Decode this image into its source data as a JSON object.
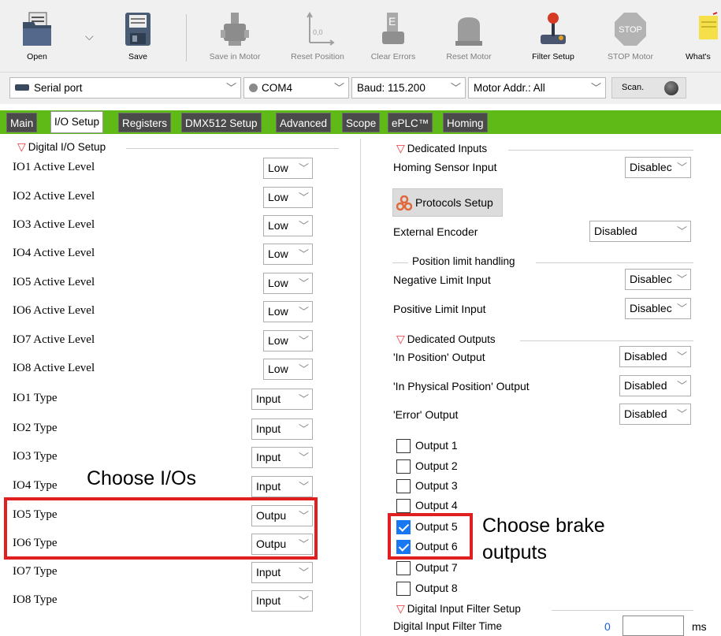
{
  "toolbar": {
    "buttons": [
      {
        "label": "Open",
        "icon": "folder-icon",
        "enabled": true
      },
      {
        "label": "Save",
        "icon": "floppy-disk-icon",
        "enabled": true
      },
      {
        "label": "Save in Motor",
        "icon": "motor-save-icon",
        "enabled": false
      },
      {
        "label": "Reset Position",
        "icon": "axis-reset-icon",
        "enabled": false
      },
      {
        "label": "Clear Errors",
        "icon": "eraser-icon",
        "enabled": false
      },
      {
        "label": "Reset Motor",
        "icon": "motor-reset-icon",
        "enabled": false
      },
      {
        "label": "Filter Setup",
        "icon": "joystick-icon",
        "enabled": true
      },
      {
        "label": "STOP Motor",
        "icon": "stop-sign-icon",
        "enabled": false
      },
      {
        "label": "What's",
        "icon": "sticky-note-icon",
        "enabled": true
      }
    ],
    "stop_sign_text": "STOP"
  },
  "connection": {
    "port_type": "Serial port",
    "com_port": "COM4",
    "baud": "Baud: 115.200",
    "motor_addr": "Motor Addr.: All",
    "scan_label": "Scan."
  },
  "tabs": [
    "Main",
    "I/O Setup",
    "Registers",
    "DMX512 Setup",
    "Advanced",
    "Scope",
    "ePLC™",
    "Homing"
  ],
  "active_tab": "I/O Setup",
  "left": {
    "section_title": "Digital I/O Setup",
    "active_levels": [
      {
        "label": "IO1 Active Level",
        "value": "Low"
      },
      {
        "label": "IO2 Active Level",
        "value": "Low"
      },
      {
        "label": "IO3  Active Level",
        "value": "Low"
      },
      {
        "label": "IO4  Active Level",
        "value": "Low"
      },
      {
        "label": "IO5  Active Level",
        "value": "Low"
      },
      {
        "label": "IO6  Active Level",
        "value": "Low"
      },
      {
        "label": "IO7  Active Level",
        "value": "Low"
      },
      {
        "label": "IO8  Active Level",
        "value": "Low"
      }
    ],
    "types": [
      {
        "label": "IO1 Type",
        "value": "Input"
      },
      {
        "label": "IO2 Type",
        "value": "Input"
      },
      {
        "label": "IO3 Type",
        "value": "Input"
      },
      {
        "label": "IO4 Type",
        "value": "Input"
      },
      {
        "label": "IO5 Type",
        "value": "Outpu"
      },
      {
        "label": "IO6 Type",
        "value": "Outpu"
      },
      {
        "label": "IO7 Type",
        "value": "Input"
      },
      {
        "label": "IO8 Type",
        "value": "Input"
      }
    ],
    "annotation": "Choose I/Os"
  },
  "right": {
    "dedicated_inputs_title": "Dedicated Inputs",
    "homing_sensor_label": "Homing Sensor Input",
    "homing_sensor_value": "Disablec",
    "protocols_button": "Protocols Setup",
    "external_encoder_label": "External Encoder",
    "external_encoder_value": "Disabled",
    "position_limit_title": "Position limit handling",
    "negative_limit_label": "Negative Limit Input",
    "negative_limit_value": "Disablec",
    "positive_limit_label": "Positive Limit Input",
    "positive_limit_value": "Disablec",
    "dedicated_outputs_title": "Dedicated Outputs",
    "in_position_label": "'In Position' Output",
    "in_position_value": "Disabled",
    "in_phys_position_label": "'In Physical Position' Output",
    "in_phys_position_value": "Disabled",
    "error_output_label": "'Error' Output",
    "error_output_value": "Disabled",
    "outputs": [
      {
        "label": "Output 1",
        "checked": false
      },
      {
        "label": "Output 2",
        "checked": false
      },
      {
        "label": "Output 3",
        "checked": false
      },
      {
        "label": "Output 4",
        "checked": false
      },
      {
        "label": "Output 5",
        "checked": true
      },
      {
        "label": "Output 6",
        "checked": true
      },
      {
        "label": "Output 7",
        "checked": false
      },
      {
        "label": "Output 8",
        "checked": false
      }
    ],
    "annotation_line1": "Choose brake",
    "annotation_line2": "outputs",
    "filter_title": "Digital Input Filter Setup",
    "filter_time_label": "Digital Input Filter Time",
    "filter_time_value": "0",
    "filter_unit": "ms"
  },
  "colors": {
    "tab_bar": "#5fba17",
    "highlight": "#e02020",
    "checkbox_checked": "#1877f2",
    "section_triangle": "#e8373a"
  }
}
